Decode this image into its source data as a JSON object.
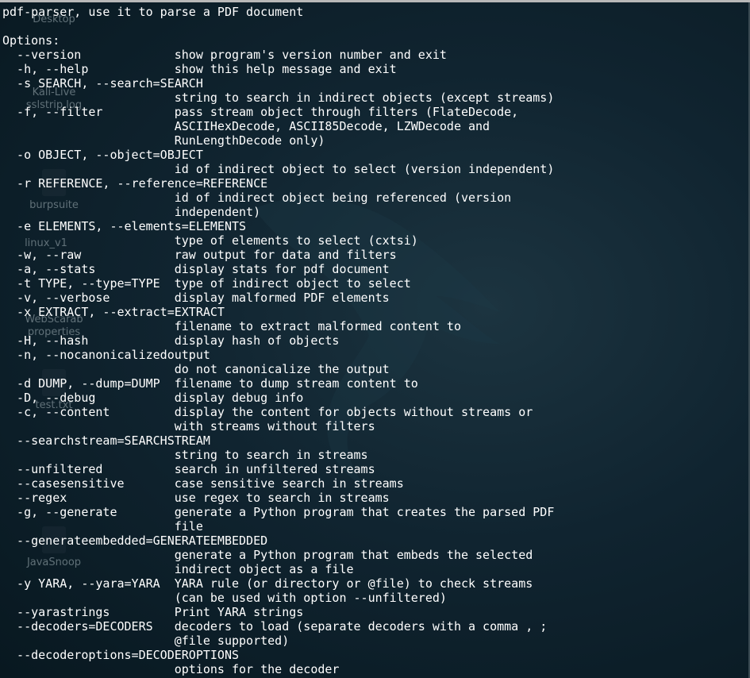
{
  "desktop": {
    "icons": [
      {
        "label": "Desktop"
      },
      {
        "label": "Kali-Live"
      },
      {
        "label": "sslstrip.log"
      },
      {
        "label": "burpsuite"
      },
      {
        "label": "linux_v1"
      },
      {
        "label": "WebScarab"
      },
      {
        "label": "properties"
      },
      {
        "label": "test.txt"
      },
      {
        "label": "JavaSnoop"
      }
    ]
  },
  "terminal": {
    "lines": [
      "pdf-parser, use it to parse a PDF document",
      "",
      "Options:",
      "  --version             show program's version number and exit",
      "  -h, --help            show this help message and exit",
      "  -s SEARCH, --search=SEARCH",
      "                        string to search in indirect objects (except streams)",
      "  -f, --filter          pass stream object through filters (FlateDecode,",
      "                        ASCIIHexDecode, ASCII85Decode, LZWDecode and",
      "                        RunLengthDecode only)",
      "  -o OBJECT, --object=OBJECT",
      "                        id of indirect object to select (version independent)",
      "  -r REFERENCE, --reference=REFERENCE",
      "                        id of indirect object being referenced (version",
      "                        independent)",
      "  -e ELEMENTS, --elements=ELEMENTS",
      "                        type of elements to select (cxtsi)",
      "  -w, --raw             raw output for data and filters",
      "  -a, --stats           display stats for pdf document",
      "  -t TYPE, --type=TYPE  type of indirect object to select",
      "  -v, --verbose         display malformed PDF elements",
      "  -x EXTRACT, --extract=EXTRACT",
      "                        filename to extract malformed content to",
      "  -H, --hash            display hash of objects",
      "  -n, --nocanonicalizedoutput",
      "                        do not canonicalize the output",
      "  -d DUMP, --dump=DUMP  filename to dump stream content to",
      "  -D, --debug           display debug info",
      "  -c, --content         display the content for objects without streams or",
      "                        with streams without filters",
      "  --searchstream=SEARCHSTREAM",
      "                        string to search in streams",
      "  --unfiltered          search in unfiltered streams",
      "  --casesensitive       case sensitive search in streams",
      "  --regex               use regex to search in streams",
      "  -g, --generate        generate a Python program that creates the parsed PDF",
      "                        file",
      "  --generateembedded=GENERATEEMBEDDED",
      "                        generate a Python program that embeds the selected",
      "                        indirect object as a file",
      "  -y YARA, --yara=YARA  YARA rule (or directory or @file) to check streams",
      "                        (can be used with option --unfiltered)",
      "  --yarastrings         Print YARA strings",
      "  --decoders=DECODERS   decoders to load (separate decoders with a comma , ;",
      "                        @file supported)",
      "  --decoderoptions=DECODEROPTIONS",
      "                        options for the decoder"
    ]
  },
  "colors": {
    "text": "#ffffff",
    "background": "#0d1e28"
  }
}
